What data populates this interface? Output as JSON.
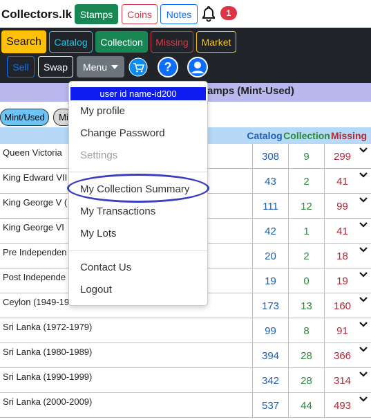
{
  "brand": "Collectors.lk",
  "top_tabs": {
    "stamps": "Stamps",
    "coins": "Coins",
    "notes": "Notes"
  },
  "notifications": {
    "count": "1"
  },
  "nav": {
    "search": "Search",
    "catalog": "Catalog",
    "collection": "Collection",
    "missing": "Missing",
    "market": "Market",
    "sell": "Sell",
    "swap": "Swap",
    "menu": "Menu"
  },
  "page_title": "amps (Mint-Used)",
  "filters": {
    "mint_used": "Mint/Used",
    "second": "Mi"
  },
  "table": {
    "headers": {
      "catalog": "Catalog",
      "collection": "Collection",
      "missing": "Missing"
    },
    "rows": [
      {
        "name": "Queen Victoria",
        "catalog": "308",
        "collection": "9",
        "missing": "299"
      },
      {
        "name": "King Edward VII",
        "catalog": "43",
        "collection": "2",
        "missing": "41"
      },
      {
        "name": "King George V (",
        "catalog": "111",
        "collection": "12",
        "missing": "99"
      },
      {
        "name": "King George VI",
        "catalog": "42",
        "collection": "1",
        "missing": "41"
      },
      {
        "name": "Pre Independen",
        "catalog": "20",
        "collection": "2",
        "missing": "18"
      },
      {
        "name": "Post Independe",
        "catalog": "19",
        "collection": "0",
        "missing": "19"
      },
      {
        "name": "Ceylon (1949-19",
        "catalog": "173",
        "collection": "13",
        "missing": "160"
      },
      {
        "name": "Sri Lanka (1972-1979)",
        "catalog": "99",
        "collection": "8",
        "missing": "91"
      },
      {
        "name": "Sri Lanka (1980-1989)",
        "catalog": "394",
        "collection": "28",
        "missing": "366"
      },
      {
        "name": "Sri Lanka (1990-1999)",
        "catalog": "342",
        "collection": "28",
        "missing": "314"
      },
      {
        "name": "Sri Lanka (2000-2009)",
        "catalog": "537",
        "collection": "44",
        "missing": "493"
      }
    ]
  },
  "dropdown": {
    "user_label": "user id name-id200",
    "items": {
      "profile": "My profile",
      "change_password": "Change Password",
      "settings": "Settings",
      "collection_summary": "My Collection Summary",
      "transactions": "My Transactions",
      "lots": "My Lots",
      "contact": "Contact Us",
      "logout": "Logout"
    }
  },
  "colors": {
    "catalog": "#1f5fb0",
    "collection": "#2b8a3e",
    "missing": "#b02a37",
    "highlight_ellipse": "#3b3fbf",
    "dark_nav": "#212529",
    "search_btn": "#ffc107"
  }
}
